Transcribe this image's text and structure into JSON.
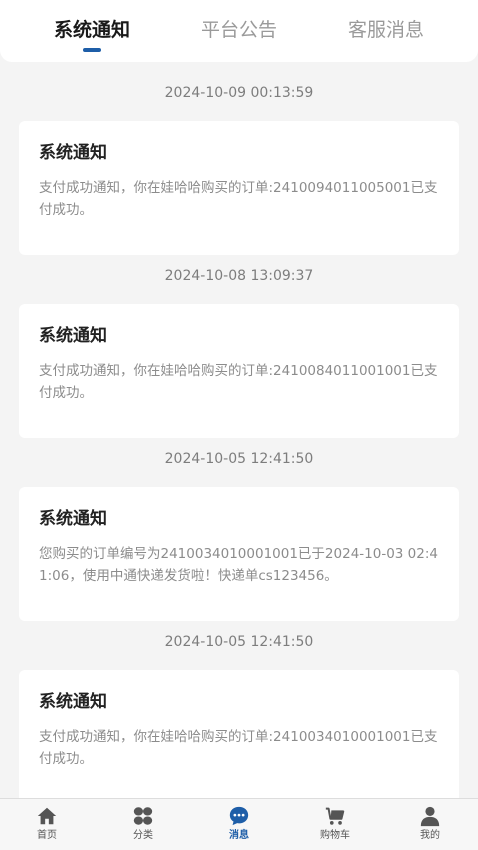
{
  "tabs": [
    {
      "label": "系统通知",
      "active": true
    },
    {
      "label": "平台公告",
      "active": false
    },
    {
      "label": "客服消息",
      "active": false
    }
  ],
  "messages": [
    {
      "time": "2024-10-09 00:13:59",
      "title": "系统通知",
      "body": "支付成功通知，你在娃哈哈购买的订单:2410094011005001已支付成功。"
    },
    {
      "time": "2024-10-08 13:09:37",
      "title": "系统通知",
      "body": "支付成功通知，你在娃哈哈购买的订单:2410084011001001已支付成功。"
    },
    {
      "time": "2024-10-05 12:41:50",
      "title": "系统通知",
      "body": "您购买的订单编号为2410034010001001已于2024-10-03 02:41:06，使用中通快递发货啦！快递单cs123456。"
    },
    {
      "time": "2024-10-05 12:41:50",
      "title": "系统通知",
      "body": "支付成功通知，你在娃哈哈购买的订单:2410034010001001已支付成功。"
    }
  ],
  "nav": [
    {
      "label": "首页",
      "icon": "home-icon",
      "active": false
    },
    {
      "label": "分类",
      "icon": "category-icon",
      "active": false
    },
    {
      "label": "消息",
      "icon": "message-icon",
      "active": true
    },
    {
      "label": "购物车",
      "icon": "cart-icon",
      "active": false
    },
    {
      "label": "我的",
      "icon": "user-icon",
      "active": false
    }
  ],
  "colors": {
    "accent": "#1e5ea8",
    "background": "#f4f4f4",
    "card": "#ffffff"
  }
}
